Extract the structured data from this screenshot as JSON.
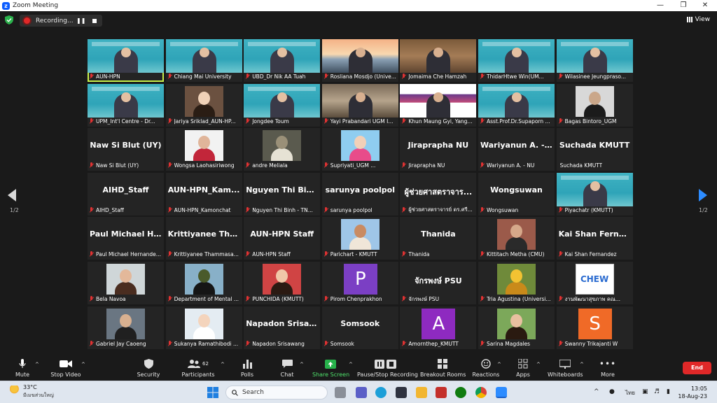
{
  "window": {
    "title": "Zoom Meeting"
  },
  "topbar": {
    "recording_label": "Recording...",
    "view_label": "View"
  },
  "gallery": {
    "page_left": "1/2",
    "page_right": "1/2",
    "tiles": [
      {
        "kind": "video",
        "style": "banner",
        "caption": "AUN-HPN",
        "active": true
      },
      {
        "kind": "video",
        "style": "banner",
        "caption": "Chiang Mai University"
      },
      {
        "kind": "video",
        "style": "banner",
        "caption": "UBD_Dr Nik AA Tuah"
      },
      {
        "kind": "video",
        "style": "sunset",
        "caption": "Rosliana Mosdjo (Unive..."
      },
      {
        "kind": "video",
        "style": "office",
        "caption": "Jomaima Che Hamzah"
      },
      {
        "kind": "video",
        "style": "banner",
        "caption": "ThidarHtwe Win(UM..."
      },
      {
        "kind": "video",
        "style": "banner",
        "caption": "Wilasinee Jeungpraso..."
      },
      {
        "kind": "video",
        "style": "banner",
        "caption": "UPM_Int'l Centre - Dr..."
      },
      {
        "kind": "photo",
        "style": "woman",
        "caption": "Jariya Sriklad_AUN-HP..."
      },
      {
        "kind": "video",
        "style": "banner",
        "caption": "Jongdee Toum"
      },
      {
        "kind": "video",
        "style": "room",
        "caption": "Yayi Prabandari UGM I..."
      },
      {
        "kind": "video",
        "style": "slide",
        "caption": "Khun Maung Gyi, Yang..."
      },
      {
        "kind": "video",
        "style": "banner",
        "caption": "Asst.Prof.Dr.Supaporn ..."
      },
      {
        "kind": "photo",
        "style": "man",
        "caption": "Bagas Bintoro_UGM"
      },
      {
        "kind": "name",
        "name": "Naw Si Blut (UY)",
        "caption": "Naw Si Blut (UY)"
      },
      {
        "kind": "photo",
        "style": "woman2",
        "caption": "Wongsa Laohasiriwong"
      },
      {
        "kind": "photo",
        "style": "car",
        "caption": "andre Meliala"
      },
      {
        "kind": "photo",
        "style": "hijab",
        "caption": "Supriyati_UGM ..."
      },
      {
        "kind": "name",
        "name": "Jiraprapha NU",
        "caption": "Jiraprapha NU"
      },
      {
        "kind": "name",
        "name": "Wariyanun A. -...",
        "caption": "Wariyanun A. - NU"
      },
      {
        "kind": "name",
        "name": "Suchada KMUTT",
        "caption": "Suchada KMUTT",
        "nomic": true
      },
      {
        "kind": "name",
        "name": "AIHD_Staff",
        "caption": "AIHD_Staff"
      },
      {
        "kind": "name",
        "name": "AUN-HPN_Kam...",
        "caption": "AUN-HPN_Kamonchat"
      },
      {
        "kind": "name",
        "name": "Nguyen Thi Bin...",
        "caption": "Nguyen Thi Binh - TN..."
      },
      {
        "kind": "name",
        "name": "sarunya poolpol",
        "caption": "sarunya poolpol"
      },
      {
        "kind": "name",
        "name": "ผู้ช่วยศาสตราจาร...",
        "caption": "ผู้ช่วยศาสตราจารย์ ดร.ศรี..."
      },
      {
        "kind": "name",
        "name": "Wongsuwan",
        "caption": "Wongsuwan"
      },
      {
        "kind": "video",
        "style": "banner",
        "caption": "Piyachatr (KMUTT)"
      },
      {
        "kind": "name",
        "name": "Paul Michael He...",
        "caption": "Paul Michael Hernande..."
      },
      {
        "kind": "name",
        "name": "Krittiyanee Tha...",
        "caption": "Krittiyanee Thammasa..."
      },
      {
        "kind": "name",
        "name": "AUN-HPN Staff",
        "caption": "AUN-HPN Staff"
      },
      {
        "kind": "photo",
        "style": "building",
        "caption": "Parichart - KMUTT"
      },
      {
        "kind": "name",
        "name": "Thanida",
        "caption": "Thanida"
      },
      {
        "kind": "photo",
        "style": "man2",
        "caption": "Kittitach Metha (CMU)"
      },
      {
        "kind": "name",
        "name": "Kai Shan Fernan...",
        "caption": "Kai Shan Fernandez"
      },
      {
        "kind": "photo",
        "style": "woman3",
        "caption": "Bela Navoa"
      },
      {
        "kind": "photo",
        "style": "grad",
        "caption": "Department of Mental ..."
      },
      {
        "kind": "photo",
        "style": "red",
        "caption": "PUNCHIDA (KMUTT)"
      },
      {
        "kind": "letter",
        "letter": "P",
        "color": "#7b3fc4",
        "caption": "Pirom Chenprakhon"
      },
      {
        "kind": "name",
        "name": "จักรพงษ์ PSU",
        "caption": "จักรพงษ์ PSU"
      },
      {
        "kind": "photo",
        "style": "flowers",
        "caption": "Tria Agustina (Universi..."
      },
      {
        "kind": "photo",
        "style": "chew",
        "caption": "งานพัฒนาสุขภาพ คณ...",
        "logo_text": "CHEW"
      },
      {
        "kind": "photo",
        "style": "man3",
        "caption": "Gabriel Jay Caoeng"
      },
      {
        "kind": "photo",
        "style": "doctor",
        "caption": "Sukanya Ramathibodi ..."
      },
      {
        "kind": "name",
        "name": "Napadon Srisaw...",
        "caption": "Napadon Srisawang"
      },
      {
        "kind": "name",
        "name": "Somsook",
        "caption": "Somsook"
      },
      {
        "kind": "letter",
        "letter": "A",
        "color": "#8e2ac0",
        "caption": "Amornthep_KMUTT"
      },
      {
        "kind": "photo",
        "style": "girl",
        "caption": "Sarina Magdales"
      },
      {
        "kind": "letter",
        "letter": "S",
        "color": "#f06a27",
        "caption": "Swanny Trikajanti W"
      }
    ]
  },
  "toolbar": {
    "mute": "Mute",
    "stop_video": "Stop Video",
    "security": "Security",
    "participants": "Participants",
    "participants_count": "62",
    "polls": "Polls",
    "chat": "Chat",
    "share_screen": "Share Screen",
    "record": "Pause/Stop Recording",
    "breakout": "Breakout Rooms",
    "reactions": "Reactions",
    "apps": "Apps",
    "whiteboards": "Whiteboards",
    "more": "More",
    "end": "End"
  },
  "taskbar": {
    "weather_temp": "33°C",
    "weather_desc": "มีเมฆส่วนใหญ่",
    "search_placeholder": "Search",
    "language": "ไทย",
    "time": "13:05",
    "date": "18-Aug-23"
  }
}
